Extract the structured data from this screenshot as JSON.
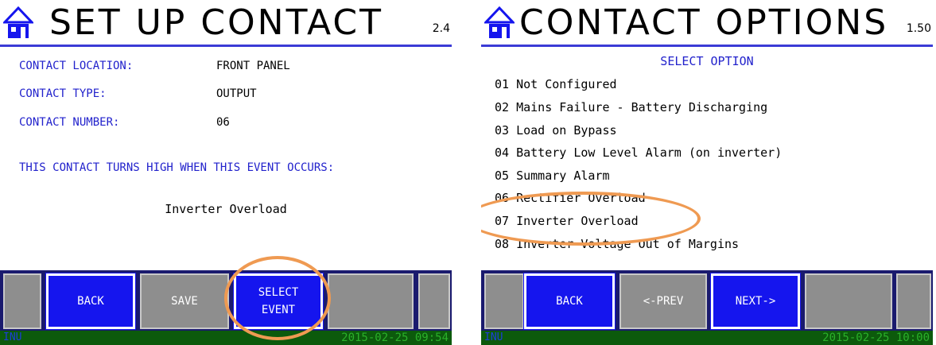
{
  "left_screen": {
    "title": "SET UP CONTACT",
    "version": "2.4",
    "rows": [
      {
        "label": "CONTACT LOCATION:",
        "value": "FRONT PANEL"
      },
      {
        "label": "CONTACT TYPE:",
        "value": "OUTPUT"
      },
      {
        "label": "CONTACT NUMBER:",
        "value": "06"
      }
    ],
    "event_heading": "THIS CONTACT TURNS HIGH WHEN THIS EVENT OCCURS:",
    "event_name": "Inverter Overload",
    "buttons": {
      "back": "BACK",
      "save": "SAVE",
      "select_event_line1": "SELECT",
      "select_event_line2": "EVENT"
    },
    "status": {
      "mode": "INU",
      "datetime": "2015-02-25 09:54"
    }
  },
  "right_screen": {
    "title": "CONTACT OPTIONS",
    "version": "1.50",
    "select_heading": "SELECT OPTION",
    "options": [
      "01 Not Configured",
      "02 Mains Failure - Battery Discharging",
      "03 Load on Bypass",
      "04 Battery Low Level Alarm (on inverter)",
      "05 Summary Alarm",
      "06 Rectifier Overload",
      "07 Inverter Overload",
      "08 Inverter Voltage Out of Margins"
    ],
    "buttons": {
      "back": "BACK",
      "prev": "<-PREV",
      "next": "NEXT->"
    },
    "status": {
      "mode": "INU",
      "datetime": "2015-02-25 10:00"
    }
  },
  "colors": {
    "label_blue": "#2222cc",
    "button_blue": "#1515ee",
    "highlight_orange": "#ef9a52",
    "status_green": "#0c5a0c"
  },
  "icons": {
    "home": "home-icon"
  }
}
